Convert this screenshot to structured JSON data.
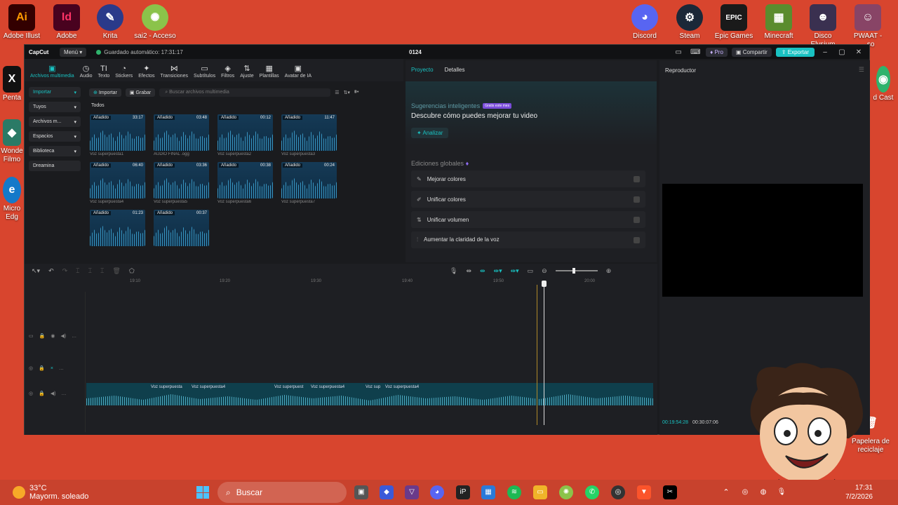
{
  "desktop": {
    "left_icons": [
      {
        "label": "Adobe Illust",
        "glyph": "Ai",
        "color": "#330000",
        "fg": "#ff9a00"
      },
      {
        "label": "Adobe",
        "glyph": "Id",
        "color": "#49021f",
        "fg": "#ff3366"
      },
      {
        "label": "Krita",
        "glyph": "K",
        "color": "#2a3a8a",
        "fg": "#ffffff"
      },
      {
        "label": "sai2 - Acceso",
        "glyph": "S",
        "color": "#8bc34a",
        "fg": "#ffffff"
      }
    ],
    "right_icons": [
      {
        "label": "Discord",
        "glyph": "D",
        "color": "#5865f2",
        "fg": "#ffffff"
      },
      {
        "label": "Steam",
        "glyph": "S",
        "color": "#1b2838",
        "fg": "#ffffff"
      },
      {
        "label": "Epic Games",
        "glyph": "EPIC",
        "color": "#1a1a1a",
        "fg": "#ffffff"
      },
      {
        "label": "Minecraft",
        "glyph": "M",
        "color": "#5a8c2e",
        "fg": "#ffffff"
      },
      {
        "label": "Disco Elysium",
        "glyph": "DE",
        "color": "#3a3050",
        "fg": "#ffffff"
      },
      {
        "label": "PWAAT - ...so",
        "glyph": "P",
        "color": "#884466",
        "fg": "#ffffff"
      }
    ],
    "side_fragments": {
      "pentax": "Penta",
      "wonder": "Wonde Filmo",
      "edge": "Micro Edg",
      "cast": "d Cast",
      "recycle": "Papelera de reciclaje"
    }
  },
  "window": {
    "app_name": "CapCut",
    "menu_label": "Menú",
    "autosave": "Guardado automático: 17:31:17",
    "project_name": "0124",
    "pro_label": "Pro",
    "share_label": "Compartir",
    "export_label": "Exportar"
  },
  "toolbar": [
    {
      "label": "Archivos multimedia",
      "icon": "▣",
      "active": true
    },
    {
      "label": "Audio",
      "icon": "◷"
    },
    {
      "label": "Texto",
      "icon": "TI"
    },
    {
      "label": "Stickers",
      "icon": "◔"
    },
    {
      "label": "Efectos",
      "icon": "✦"
    },
    {
      "label": "Transiciones",
      "icon": "⋈"
    },
    {
      "label": "Subtítulos",
      "icon": "▭"
    },
    {
      "label": "Filtros",
      "icon": "◈"
    },
    {
      "label": "Ajuste",
      "icon": "⇅"
    },
    {
      "label": "Plantillas",
      "icon": "▦"
    },
    {
      "label": "Avatar de IA",
      "icon": "▣"
    }
  ],
  "sidebar": [
    {
      "label": "Importar",
      "active": true
    },
    {
      "label": "Tuyos"
    },
    {
      "label": "Archivos m..."
    },
    {
      "label": "Espacios"
    },
    {
      "label": "Biblioteca"
    },
    {
      "label": "Dreamina"
    }
  ],
  "media": {
    "import_label": "Importar",
    "record_label": "Grabar",
    "search_placeholder": "Buscar archivos multimedia",
    "section_label": "Todos",
    "added_label": "Añadido",
    "items": [
      {
        "duration": "33:17",
        "name": "Voz superpuesta1"
      },
      {
        "duration": "03:48",
        "name": "AUDIO FINAL .ogg"
      },
      {
        "duration": "00:12",
        "name": "Voz superpuesta2"
      },
      {
        "duration": "11:47",
        "name": "Voz superpuesta3"
      },
      {
        "duration": "06:40",
        "name": "Voz superpuesta4"
      },
      {
        "duration": "03:36",
        "name": "Voz superpuesta5"
      },
      {
        "duration": "00:38",
        "name": "Voz superpuesta6"
      },
      {
        "duration": "00:24",
        "name": "Voz superpuesta7"
      },
      {
        "duration": "01:23",
        "name": ""
      },
      {
        "duration": "00:37",
        "name": ""
      }
    ]
  },
  "project_panel": {
    "tab_project": "Proyecto",
    "tab_details": "Detalles",
    "suggest_title": "Sugerencias inteligentes",
    "suggest_badge": "Gratis este mes",
    "suggest_heading": "Descubre cómo puedes mejorar tu video",
    "analyze_label": "Analizar",
    "globals_title": "Ediciones globales",
    "global_items": [
      {
        "label": "Mejorar colores",
        "icon": "✎"
      },
      {
        "label": "Unificar colores",
        "icon": "✐"
      },
      {
        "label": "Unificar volumen",
        "icon": "⇅"
      },
      {
        "label": "Aumentar la claridad de la voz",
        "icon": "⫶"
      }
    ]
  },
  "player": {
    "title": "Reproductor",
    "current_time": "00:19:54:28",
    "total_time": "00:30:07:06"
  },
  "timeline": {
    "ruler": [
      "19:10",
      "19:20",
      "19:30",
      "19:40",
      "19:50",
      "20:00"
    ],
    "clips": [
      "Voz superpuesta",
      "Voz superpuesta4",
      "Voz superpuest",
      "Voz superpuesta4",
      "Voz sup",
      "Voz superpuesta4"
    ]
  },
  "taskbar": {
    "temperature": "33°C",
    "weather": "Mayorm. soleado",
    "search_label": "Buscar",
    "time": "17:31",
    "date": "7/2/2026"
  }
}
